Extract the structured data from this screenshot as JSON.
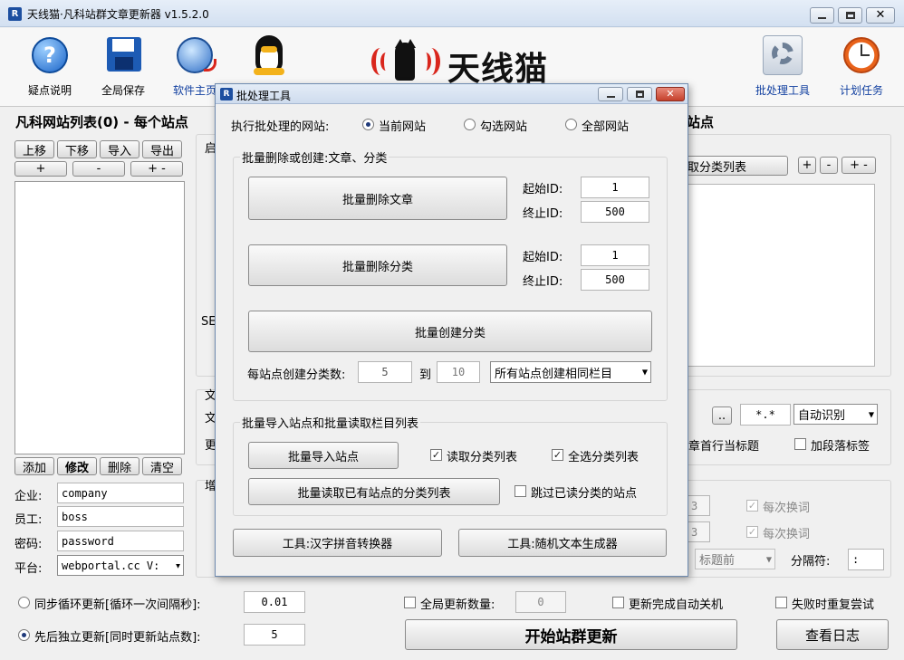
{
  "window": {
    "title": "天线猫·凡科站群文章更新器 v1.5.2.0"
  },
  "toolbar": {
    "help": "疑点说明",
    "save": "全局保存",
    "site": "软件主页",
    "batch": "批处理工具",
    "schedule": "计划任务"
  },
  "logo": {
    "text": "天线猫"
  },
  "left": {
    "title": "凡科网站列表(0) - 每个站点",
    "up": "上移",
    "down": "下移",
    "import": "导入",
    "export": "导出",
    "plus": "+",
    "minus": "-",
    "plusminus": "+ -",
    "add": "添加",
    "edit": "修改",
    "delete": "删除",
    "clear": "清空",
    "company_label": "企业:",
    "company_value": "company",
    "staff_label": "员工:",
    "staff_value": "boss",
    "password_label": "密码:",
    "password_value": "password",
    "platform_label": "平台:",
    "platform_value": "webportal.cc V:"
  },
  "bg": {
    "title_right": "站点",
    "start": "启",
    "se": "SE",
    "wen1": "文",
    "wen2": "文",
    "geng": "更",
    "zeng": "增",
    "fetch_list": "取分类列表",
    "plus": "+",
    "minus": "-",
    "plusminus": "+ -",
    "browse": "..",
    "pattern": "*.*",
    "auto": "自动识别",
    "first_line": "章首行当标题",
    "paragraph_tag": "加段落标签",
    "num1": "3",
    "num2": "3",
    "each1": "每次换词",
    "each2": "每次换词",
    "title_pos": "标题前",
    "separator_label": "分隔符:",
    "separator_value": ":"
  },
  "bottom": {
    "sync_label": "同步循环更新[循环一次间隔秒]:",
    "sync_value": "0.01",
    "async_label": "先后独立更新[同时更新站点数]:",
    "async_value": "5",
    "global_count_label": "全局更新数量:",
    "global_count_value": "0",
    "shutdown": "更新完成自动关机",
    "retry": "失败时重复尝试",
    "start": "开始站群更新",
    "log": "查看日志"
  },
  "dialog": {
    "title": "批处理工具",
    "target_label": "执行批处理的网站:",
    "radio_current": "当前网站",
    "radio_checked": "勾选网站",
    "radio_all": "全部网站",
    "group1_title": "批量删除或创建:文章、分类",
    "delete_articles": "批量删除文章",
    "delete_categories": "批量删除分类",
    "create_categories": "批量创建分类",
    "start_id_label": "起始ID:",
    "end_id_label": "终止ID:",
    "art_start": "1",
    "art_end": "500",
    "cat_start": "1",
    "cat_end": "500",
    "per_site_label": "每站点创建分类数:",
    "per_min": "5",
    "to_label": "到",
    "per_max": "10",
    "mode": "所有站点创建相同栏目",
    "group2_title": "批量导入站点和批量读取栏目列表",
    "import_sites": "批量导入站点",
    "read_list": "读取分类列表",
    "select_all": "全选分类列表",
    "read_existing": "批量读取已有站点的分类列表",
    "skip_read": "跳过已读分类的站点",
    "pinyin": "工具:汉字拼音转换器",
    "random_text": "工具:随机文本生成器"
  },
  "colors": {
    "titlebar": "#dbe6f4",
    "accent_red": "#d9261c",
    "logo_black": "#111111"
  }
}
